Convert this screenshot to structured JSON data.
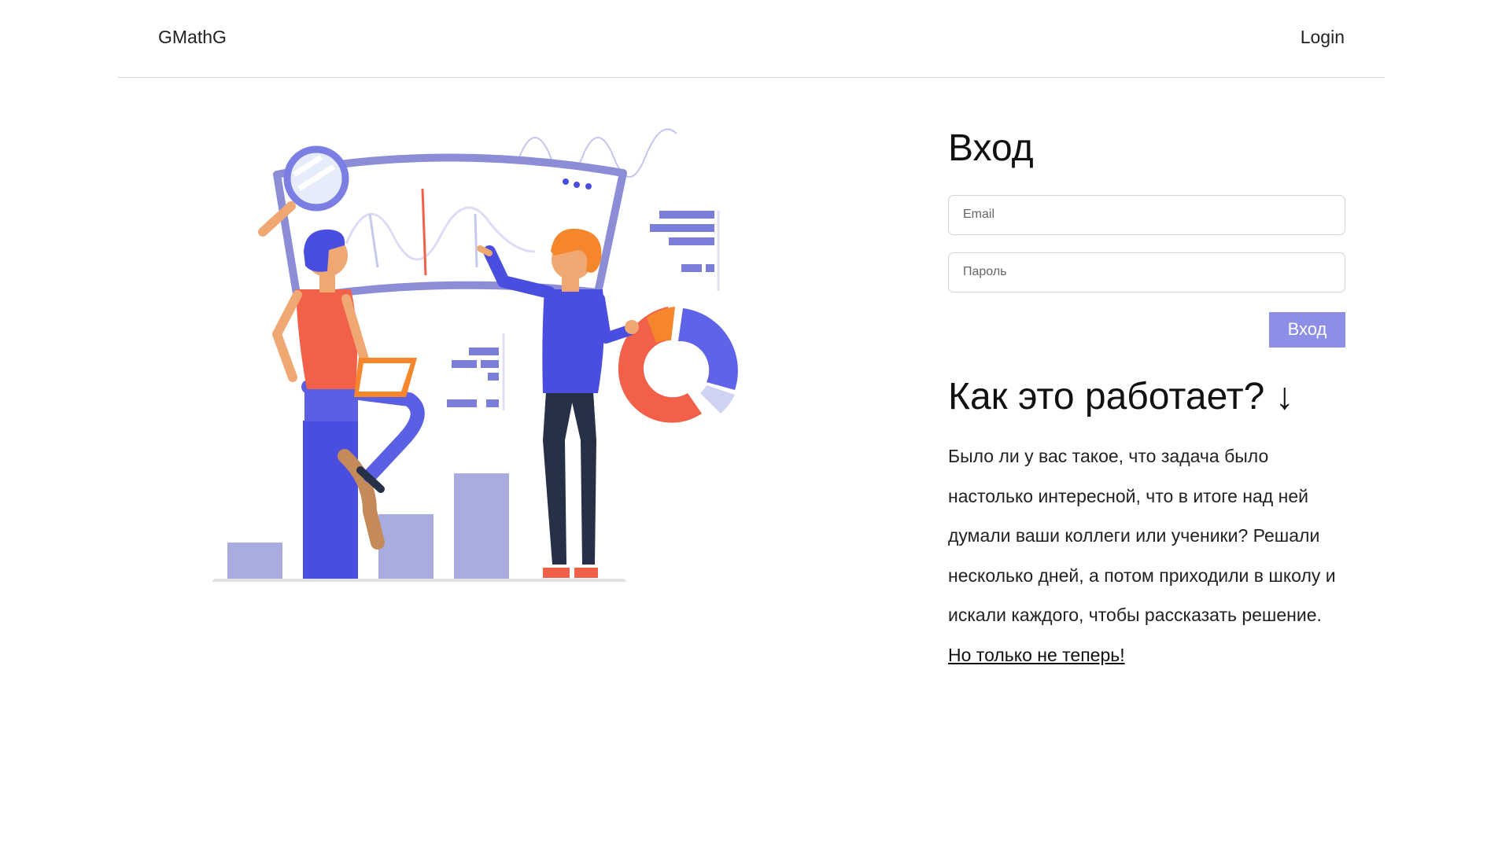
{
  "header": {
    "brand": "GMathG",
    "login_link": "Login"
  },
  "login_form": {
    "title": "Вход",
    "email_placeholder": "Email",
    "password_placeholder": "Пароль",
    "submit_label": "Вход"
  },
  "how_it_works": {
    "title": "Как это работает? ↓",
    "text": "Было ли у вас такое, что задача было настолько интересной, что в итоге над ней думали ваши коллеги или ученики? Решали несколько дней, а потом приходили в школу и искали каждого, чтобы рассказать решение.",
    "link_text": "Но только не теперь!"
  },
  "colors": {
    "accent": "#8d8fe6",
    "illustration_blue": "#4a4ee0",
    "illustration_lavender": "#a9acdf",
    "illustration_red": "#f2604a",
    "illustration_orange": "#f5862c",
    "illustration_navy": "#263046"
  }
}
